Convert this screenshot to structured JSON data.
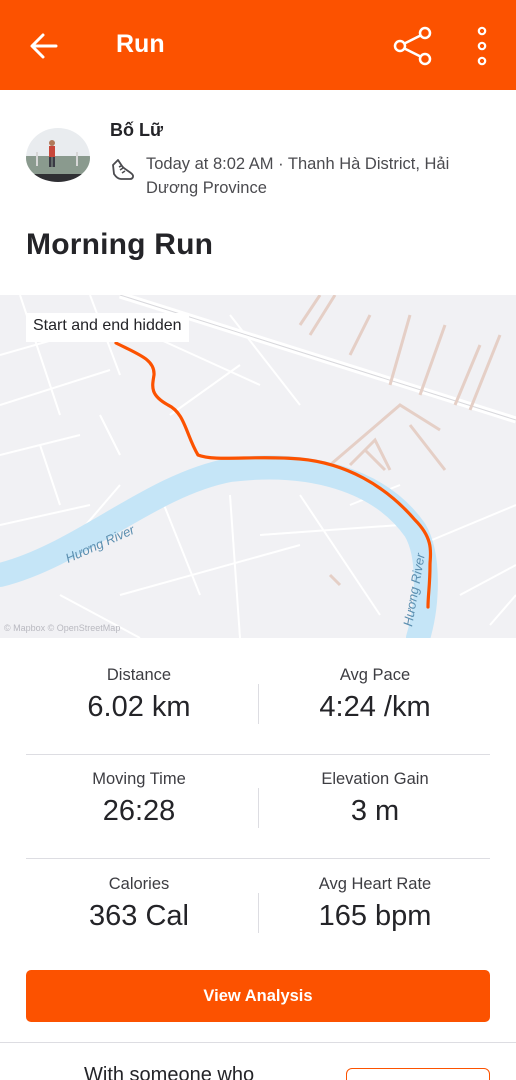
{
  "header": {
    "title": "Run",
    "back_icon": "arrow-left-icon",
    "share_icon": "share-icon",
    "more_icon": "more-vertical-icon",
    "accent_color": "#fc5200"
  },
  "athlete": {
    "name": "Bố Lữ",
    "activity_icon": "running-shoe-icon",
    "meta": "Today at 8:02 AM · Thanh Hà District, Hải Dương Province"
  },
  "activity": {
    "title": "Morning Run"
  },
  "map": {
    "privacy_label": "Start and end hidden",
    "river_label_1": "Hương River",
    "river_label_2": "Hương River",
    "attribution": "© Mapbox © OpenStreetMap",
    "route_color": "#fc5200",
    "river_color": "#c5e5f7"
  },
  "stats": [
    {
      "label": "Distance",
      "value": "6.02 km"
    },
    {
      "label": "Avg Pace",
      "value": "4:24 /km"
    },
    {
      "label": "Moving Time",
      "value": "26:28"
    },
    {
      "label": "Elevation Gain",
      "value": "3 m"
    },
    {
      "label": "Calories",
      "value": "363 Cal"
    },
    {
      "label": "Avg Heart Rate",
      "value": "165 bpm"
    }
  ],
  "actions": {
    "view_analysis": "View Analysis"
  },
  "footer": {
    "with_someone": "With someone who"
  }
}
